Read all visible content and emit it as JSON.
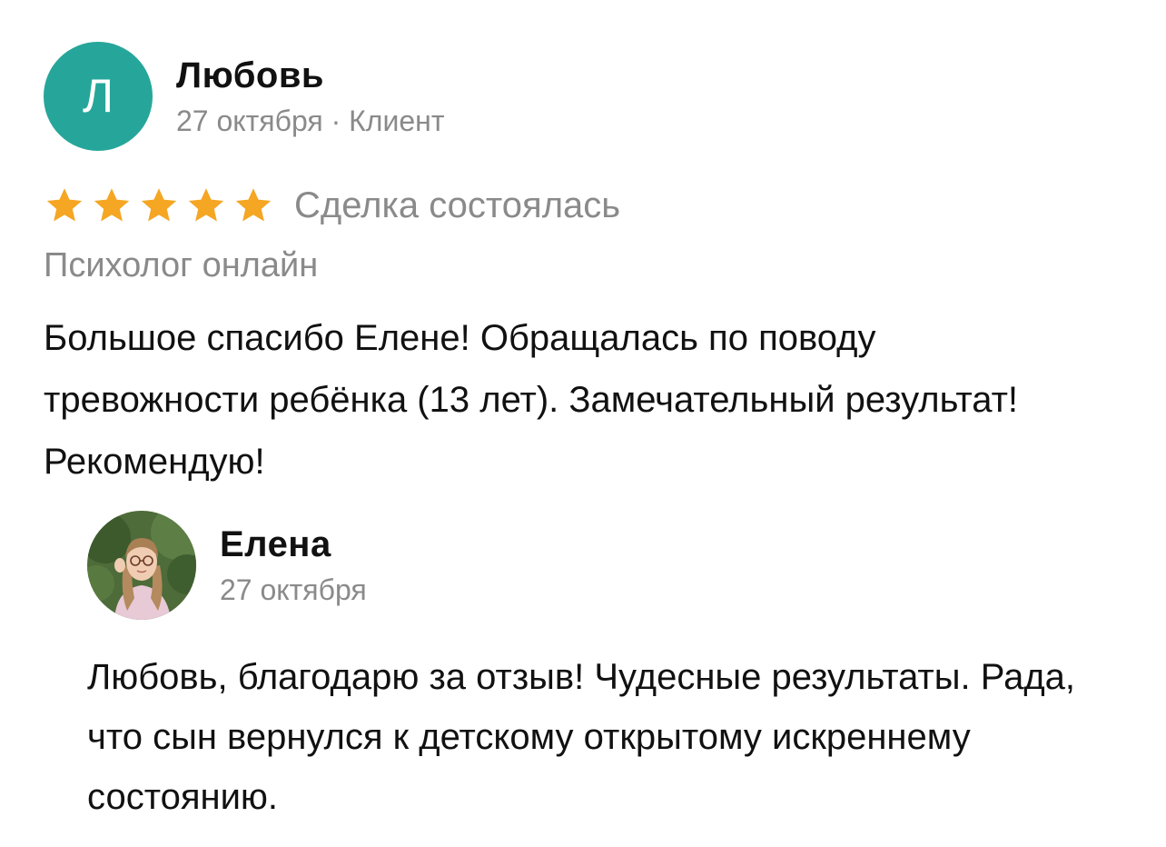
{
  "review": {
    "author": {
      "initial": "Л",
      "name": "Любовь",
      "meta": "27 октября · Клиент",
      "avatar_color": "#26a69a"
    },
    "rating": {
      "stars": 5,
      "max": 5,
      "star_color": "#f5a623",
      "icon": "star-icon"
    },
    "deal_status": "Сделка состоялась",
    "service": "Психолог онлайн",
    "text": "Большое спасибо Елене! Обращалась по поводу тревожности ребёнка (13 лет). Замечательный результат! Рекомендую!"
  },
  "reply": {
    "author": {
      "name": "Елена",
      "date": "27 октября",
      "avatar_icon": "user-photo-avatar"
    },
    "text": "Любовь, благодарю за отзыв! Чудесные результаты. Рада, что сын вернулся к детскому открытому искреннему состоянию."
  }
}
